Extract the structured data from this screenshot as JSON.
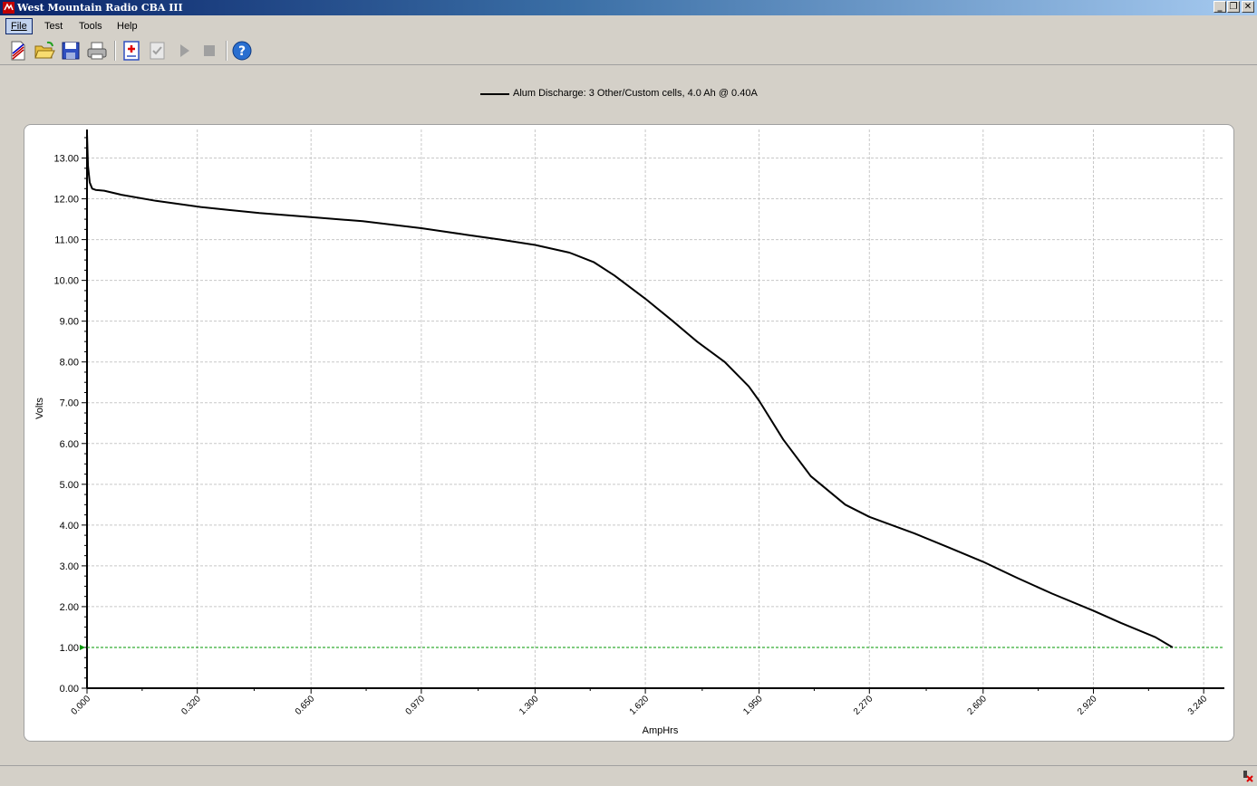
{
  "window": {
    "title": "West Mountain Radio CBA III"
  },
  "menu": {
    "items": [
      "File",
      "Test",
      "Tools",
      "Help"
    ]
  },
  "toolbar": {
    "icons": [
      "new-document-icon",
      "open-folder-icon",
      "save-icon",
      "print-icon",
      "add-test-icon",
      "checklist-icon",
      "play-icon",
      "stop-icon",
      "help-icon"
    ]
  },
  "legend": {
    "label": "Alum Discharge: 3 Other/Custom cells, 4.0 Ah @ 0.40A"
  },
  "chart_data": {
    "type": "line",
    "xlabel": "AmpHrs",
    "ylabel": "Volts",
    "xlim": [
      0,
      3.3
    ],
    "ylim": [
      0,
      13.7
    ],
    "x_ticks": [
      "0.000",
      "0.320",
      "0.650",
      "0.970",
      "1.300",
      "1.620",
      "1.950",
      "2.270",
      "2.600",
      "2.920",
      "3.240"
    ],
    "y_ticks": [
      "0.00",
      "1.00",
      "2.00",
      "3.00",
      "4.00",
      "5.00",
      "6.00",
      "7.00",
      "8.00",
      "9.00",
      "10.00",
      "11.00",
      "12.00",
      "13.00"
    ],
    "grid": true,
    "legend_position": "top-center",
    "series": [
      {
        "name": "Alum Discharge: 3 Other/Custom cells, 4.0 Ah @ 0.40A",
        "color": "#000000",
        "x": [
          0.0,
          0.003,
          0.008,
          0.015,
          0.025,
          0.05,
          0.1,
          0.2,
          0.33,
          0.5,
          0.65,
          0.8,
          0.97,
          1.1,
          1.2,
          1.3,
          1.4,
          1.47,
          1.53,
          1.62,
          1.7,
          1.77,
          1.85,
          1.92,
          1.95,
          2.02,
          2.1,
          2.2,
          2.27,
          2.4,
          2.5,
          2.6,
          2.7,
          2.8,
          2.92,
          3.0,
          3.1,
          3.15
        ],
        "y": [
          13.6,
          12.8,
          12.4,
          12.25,
          12.22,
          12.2,
          12.1,
          11.95,
          11.8,
          11.65,
          11.55,
          11.45,
          11.28,
          11.12,
          11.0,
          10.87,
          10.68,
          10.45,
          10.12,
          9.55,
          9.0,
          8.5,
          8.0,
          7.4,
          7.05,
          6.1,
          5.2,
          4.5,
          4.2,
          3.8,
          3.45,
          3.1,
          2.7,
          2.32,
          1.9,
          1.6,
          1.25,
          1.0
        ]
      }
    ],
    "reference_line": {
      "y": 1.0,
      "color": "#009900"
    }
  }
}
